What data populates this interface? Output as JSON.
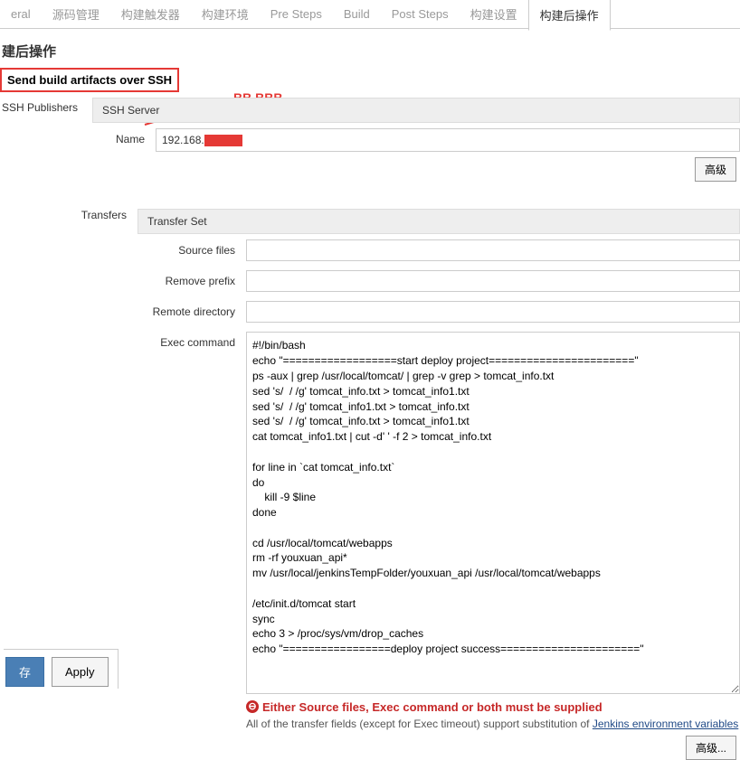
{
  "tabs": {
    "t0": "eral",
    "t1": "源码管理",
    "t2": "构建触发器",
    "t3": "构建环境",
    "t4": "Pre Steps",
    "t5": "Build",
    "t6": "Post Steps",
    "t7": "构建设置",
    "t8": "构建后操作"
  },
  "section": {
    "title": "建后操作",
    "ssh_header": "Send build artifacts over SSH"
  },
  "sidebar": {
    "publishers": "SSH Publishers"
  },
  "annotation": {
    "bb": "BB.BBB"
  },
  "server": {
    "section_label": "SSH Server",
    "name_label": "Name",
    "name_value": "192.168."
  },
  "transfers": {
    "label": "Transfers",
    "set_label": "Transfer Set",
    "source_label": "Source files",
    "source_value": "",
    "remove_prefix_label": "Remove prefix",
    "remove_prefix_value": "",
    "remote_dir_label": "Remote directory",
    "remote_dir_value": "",
    "exec_label": "Exec command",
    "exec_value": "#!/bin/bash\necho \"==================start deploy project=======================\"\nps -aux | grep /usr/local/tomcat/ | grep -v grep > tomcat_info.txt\nsed 's/  / /g' tomcat_info.txt > tomcat_info1.txt\nsed 's/  / /g' tomcat_info1.txt > tomcat_info.txt\nsed 's/  / /g' tomcat_info.txt > tomcat_info1.txt\ncat tomcat_info1.txt | cut -d' ' -f 2 > tomcat_info.txt\n\nfor line in `cat tomcat_info.txt`\ndo\n    kill -9 $line\ndone\n\ncd /usr/local/tomcat/webapps\nrm -rf youxuan_api*\nmv /usr/local/jenkinsTempFolder/youxuan_api /usr/local/tomcat/webapps\n\n/etc/init.d/tomcat start\nsync\necho 3 > /proc/sys/vm/drop_caches\necho \"=================deploy project success======================\""
  },
  "validation": {
    "error": "Either Source files, Exec command or both must be supplied",
    "help_pre": "All of the transfer fields (except for Exec timeout) support substitution of ",
    "help_link": "Jenkins environment variables"
  },
  "buttons": {
    "advanced_top": "高级",
    "advanced_bottom": "高级...",
    "save": "存",
    "apply": "Apply"
  }
}
